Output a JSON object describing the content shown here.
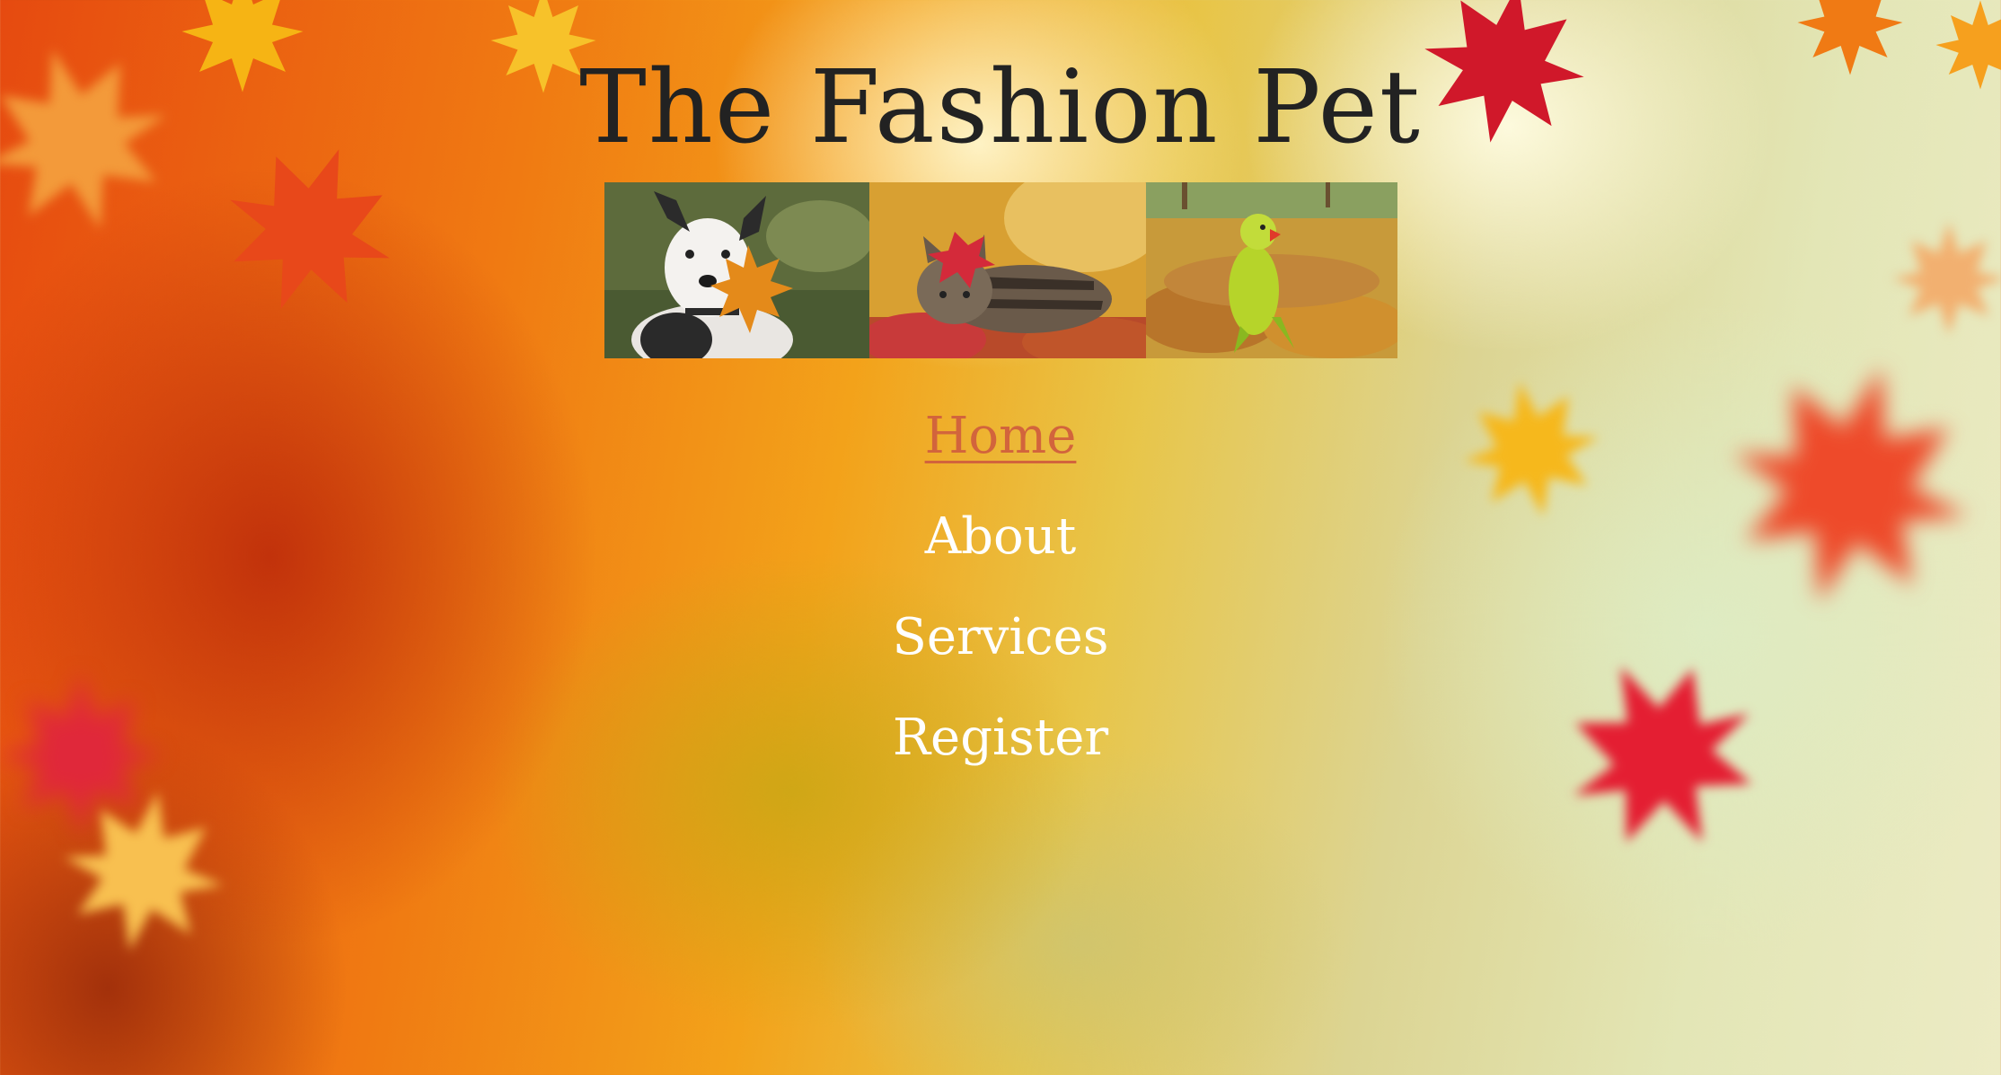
{
  "site": {
    "title": "The Fashion Pet"
  },
  "banner": {
    "photos": [
      {
        "name": "dog-with-leaf-photo",
        "subject": "dog holding autumn leaf"
      },
      {
        "name": "cat-in-leaves-photo",
        "subject": "tabby cat in red leaves"
      },
      {
        "name": "parrot-in-leaves-photo",
        "subject": "green parrot on fallen leaves"
      }
    ]
  },
  "nav": {
    "items": [
      {
        "label": "Home",
        "active": true
      },
      {
        "label": "About",
        "active": false
      },
      {
        "label": "Services",
        "active": false
      },
      {
        "label": "Register",
        "active": false
      }
    ]
  },
  "colors": {
    "title_text": "#222222",
    "nav_text": "#ffffff",
    "nav_active": "#d2643c"
  }
}
